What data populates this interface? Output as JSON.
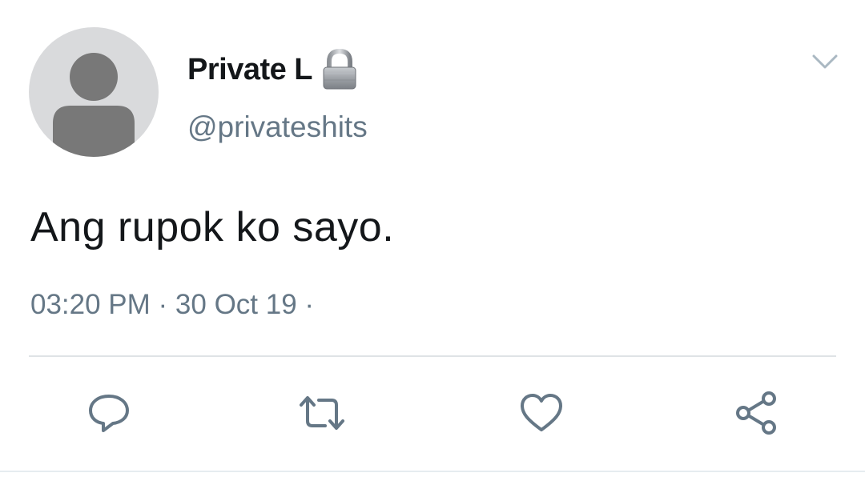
{
  "tweet": {
    "display_name": "Private L",
    "handle": "@privateshits",
    "text": "Ang rupok ko sayo.",
    "time": "03:20 PM",
    "date": "30 Oct 19",
    "separator": " · "
  },
  "icons": {
    "avatar": "default-avatar-icon",
    "protected": "lock-icon",
    "more": "chevron-down-icon",
    "reply": "reply-icon",
    "retweet": "retweet-icon",
    "like": "heart-icon",
    "share": "share-icon"
  },
  "colors": {
    "text_primary": "#14171a",
    "text_secondary": "#657786",
    "icon": "#657786",
    "divider": "#dfe3e6",
    "avatar_bg": "#d9dadc",
    "avatar_fg": "#787878"
  }
}
